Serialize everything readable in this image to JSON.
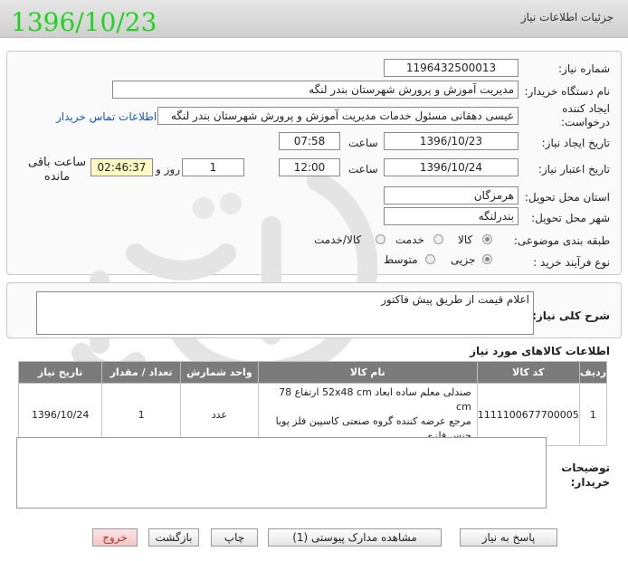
{
  "header": {
    "title": "جزئیات اطلاعات نیاز",
    "date_stamp": "1396/10/23"
  },
  "form": {
    "need_number_label": "شماره نیاز:",
    "need_number": "1196432500013",
    "buyer_org_label": "نام دستگاه خریدار:",
    "buyer_org": "مدیریت آموزش و پرورش شهرستان بندر لنگه",
    "requester_label_1": "ایجاد کننده",
    "requester_label_2": "درخواست:",
    "requester": "عیسی دهقانی  مسئول خدمات مدیریت آموزش و پرورش شهرستان بندر لنگه",
    "contact_link": "اطلاعات تماس خریدار",
    "create_date_label": "تاریخ ایجاد نیاز:",
    "create_date": "1396/10/23",
    "create_time_label": "ساعت",
    "create_time": "07:58",
    "valid_date_label": "تاریخ اعتبار نیاز:",
    "valid_date": "1396/10/24",
    "valid_time_label": "ساعت",
    "valid_time": "12:00",
    "days": "1",
    "days_label": "روز و",
    "remaining_time": "02:46:37",
    "remaining_label_1": "ساعت باقی",
    "remaining_label_2": "مانده",
    "province_label": "استان محل تحویل:",
    "province": "هرمزگان",
    "city_label": "شهر محل تحویل:",
    "city": "بندرلنگه",
    "category_label": "طبقه بندی موضوعی:",
    "category_options": [
      "کالا",
      "خدمت",
      "کالا/خدمت"
    ],
    "purchase_type_label": "نوع فرآیند خرید :",
    "purchase_type_options": [
      "جزیی",
      "متوسط"
    ]
  },
  "description": {
    "label": "شرح کلی نیاز:",
    "text": "اعلام قیمت از طریق پیش فاکتور"
  },
  "goods": {
    "title": "اطلاعات کالاهای مورد نیاز",
    "columns": [
      "ردیف",
      "کد کالا",
      "نام کالا",
      "واحد شمارش",
      "تعداد / مقدار",
      "تاریخ نیاز"
    ],
    "rows": [
      {
        "row": "1",
        "code": "1111100677700005",
        "name_line1": "صندلی معلم ساده ابعاد 52x48 cm ارتفاع 78 cm",
        "name_line2": "مرجع عرضه کننده گروه صنعتی کاسپین فلز پویا",
        "name_line3": "جنس فلزی",
        "unit": "عدد",
        "qty": "1",
        "date": "1396/10/24"
      }
    ]
  },
  "buyer_notes": {
    "label_1": "توضیحات",
    "label_2": "خریدار:"
  },
  "buttons": {
    "reply": "پاسخ به نیاز",
    "attachments": "مشاهده مدارک پیوستی (1)",
    "print": "چاپ",
    "back": "بازگشت",
    "exit": "خروج"
  }
}
